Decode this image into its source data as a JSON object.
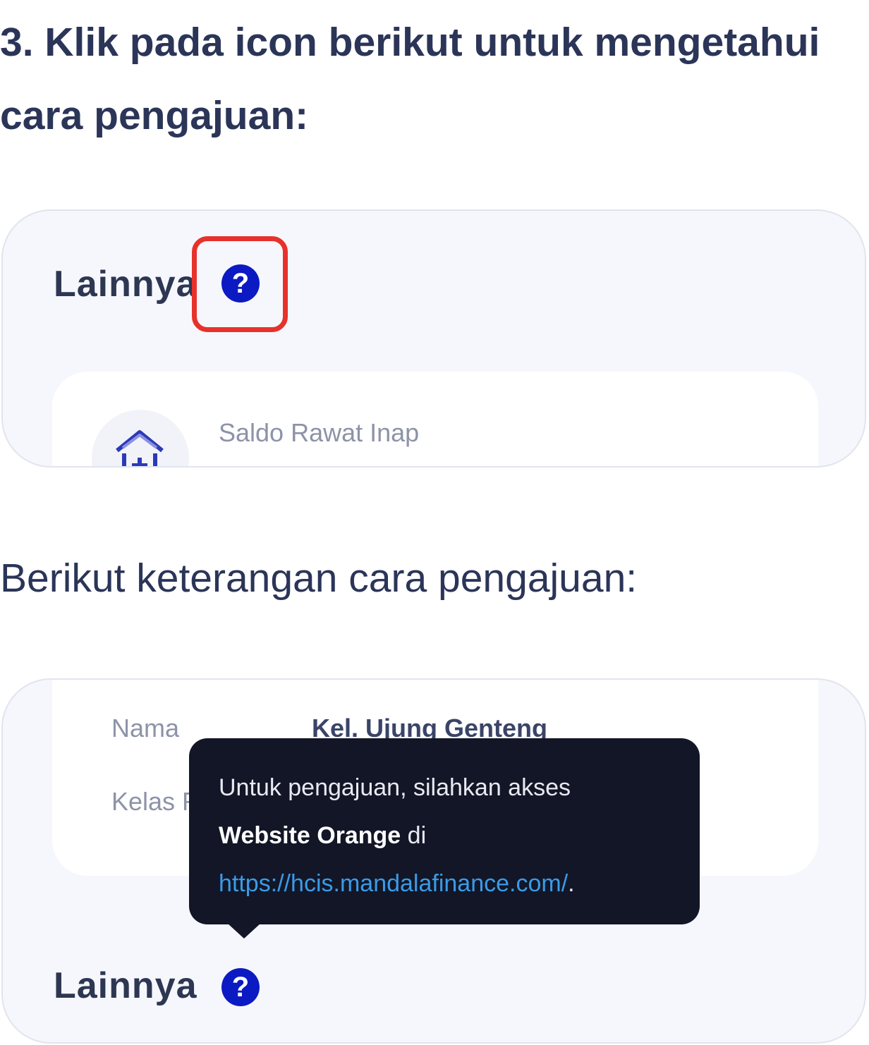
{
  "heading": "3. Klik pada icon berikut untuk mengetahui cara pengajuan:",
  "description": "Berikut keterangan cara pengajuan:",
  "screenshot1": {
    "section_title": "Lainnya",
    "help_icon_glyph": "?",
    "item_label": "Saldo Rawat Inap",
    "item_icon": "house-medical-icon",
    "highlight_color": "#e7312b"
  },
  "screenshot2": {
    "row1_label": "Nama",
    "row1_value": "Kel. Ujung Genteng",
    "row2_label": "Kelas R",
    "tooltip": {
      "line1": "Untuk pengajuan, silahkan akses",
      "bold_text": "Website Orange",
      "after_bold": " di",
      "link": "https://hcis.mandalafinance.com/",
      "after_link": "."
    },
    "section_title": "Lainnya",
    "help_icon_glyph": "?"
  },
  "colors": {
    "text": "#2b3558",
    "help_icon": "#0c1ac4",
    "tooltip_bg": "#121626",
    "link": "#3a9be8"
  }
}
